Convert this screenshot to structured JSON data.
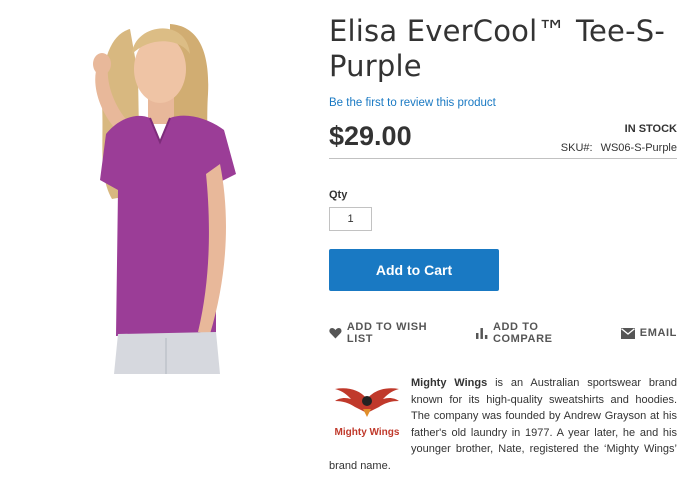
{
  "product": {
    "title": "Elisa EverCool™ Tee-S-Purple",
    "review_link": "Be the first to review this product",
    "price": "$29.00",
    "stock_status": "IN STOCK",
    "sku_label": "SKU#:",
    "sku_value": "WS06-S-Purple",
    "shirt_color": "#9b3d97"
  },
  "purchase": {
    "qty_label": "Qty",
    "qty_value": "1",
    "add_to_cart_label": "Add to Cart",
    "button_color": "#1979c3"
  },
  "actions": {
    "wishlist": "ADD TO WISH LIST",
    "compare": "ADD TO COMPARE",
    "email": "EMAIL"
  },
  "brand": {
    "logo_text": "Mighty Wings",
    "name": "Mighty Wings",
    "description": " is an Australian sportswear brand known for its high-quality sweatshirts and hoodies. The company was founded by Andrew Grayson at his father's old laundry in 1977. A year later, he and his younger brother, Nate, registered the ‘Mighty Wings’ brand name."
  }
}
